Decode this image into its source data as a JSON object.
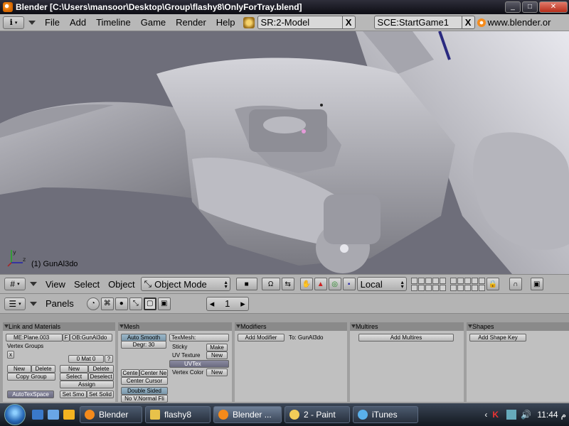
{
  "window": {
    "title": "Blender [C:\\Users\\mansoor\\Desktop\\Group\\flashy8\\OnlyForTray.blend]",
    "minimize": "_",
    "maximize": "□",
    "close": "✕"
  },
  "top_header": {
    "info_button": "i",
    "menus": [
      "File",
      "Add",
      "Timeline",
      "Game",
      "Render",
      "Help"
    ],
    "screen_field": "SR:2-Model",
    "scene_field": "SCE:StartGame1",
    "close_x": "X",
    "url": "www.blender.or"
  },
  "viewport": {
    "object_label": "(1) GunAl3do",
    "axis_y": "y",
    "axis_z": "z"
  },
  "view_header": {
    "menus": [
      "View",
      "Select",
      "Object"
    ],
    "mode": "Object Mode",
    "orientation": "Local"
  },
  "buttons_header": {
    "panels_label": "Panels",
    "frame": "1",
    "prev": "◂",
    "next": "▸"
  },
  "panels": {
    "link": {
      "title": "Link and Materials",
      "mesh_name": "ME:Plane.003",
      "f_label": "F",
      "ob_name": "OB:GunAl3do",
      "vertex_groups": "Vertex Groups",
      "mat": "0 Mat 0",
      "q": "?",
      "new": "New",
      "delete": "Delete",
      "copy_group": "Copy Group",
      "new2": "New",
      "delete2": "Delete",
      "select": "Select",
      "deselect": "Deselect",
      "assign": "Assign",
      "autotexspace": "AutoTexSpace",
      "set_smo": "Set Smo",
      "set_solid": "Set Solid"
    },
    "mesh": {
      "title": "Mesh",
      "auto_smooth": "Auto Smooth",
      "degr": "Degr: 30",
      "texmesh": "TexMesh:",
      "sticky": "Sticky",
      "make": "Make",
      "uv_texture": "UV Texture",
      "new": "New",
      "uvtex": "UVTex",
      "vertex_color": "Vertex Color",
      "new2": "New",
      "centre": "Cente",
      "center_new": "Center Ne",
      "center_cursor": "Center Cursor",
      "double_sided": "Double Sided",
      "no_vnormal": "No V.Normal Fli"
    },
    "modifiers": {
      "title": "Modifiers",
      "add": "Add Modifier",
      "to": "To: GunAl3do"
    },
    "multires": {
      "title": "Multires",
      "add": "Add Multires"
    },
    "shapes": {
      "title": "Shapes",
      "add": "Add Shape Key"
    }
  },
  "taskbar": {
    "tasks": [
      "Blender",
      "flashy8",
      "Blender ...",
      "2 - Paint",
      "iTunes"
    ],
    "clock": "11:44",
    "ampm": "م"
  }
}
